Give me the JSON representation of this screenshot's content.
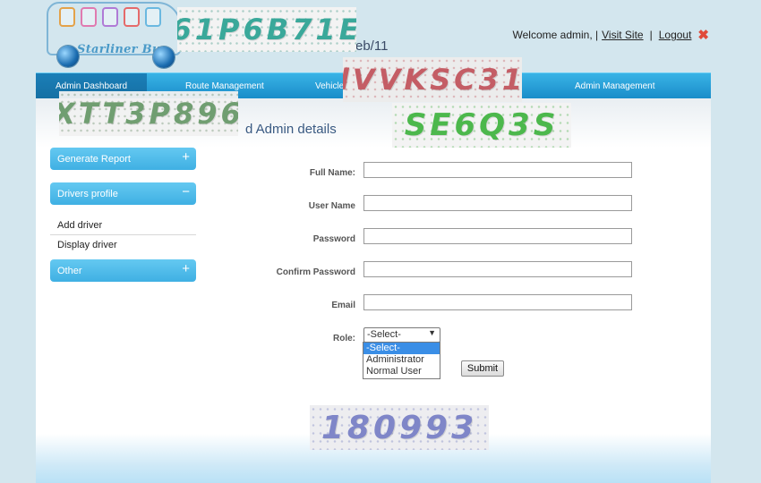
{
  "logo": {
    "brand": "Starliner Bus"
  },
  "header": {
    "date_fragment": "eb/11"
  },
  "topbar": {
    "welcome": "Welcome admin, |",
    "visit_site": "Visit Site",
    "divider": "|",
    "logout": "Logout",
    "logout_icon": "close-icon"
  },
  "nav": {
    "items": [
      {
        "label": "Admin Dashboard"
      },
      {
        "label": "Route Management"
      },
      {
        "label": "Vehicle"
      },
      {
        "label": "Admin Management"
      }
    ]
  },
  "page": {
    "title": "d Admin details"
  },
  "sidebar": {
    "sections": [
      {
        "label": "Generate Report",
        "sign": "+"
      },
      {
        "label": "Drivers profile",
        "sign": "−",
        "links": [
          "Add driver",
          "Display driver"
        ]
      },
      {
        "label": "Other",
        "sign": "+"
      }
    ]
  },
  "form": {
    "full_name": {
      "label": "Full Name:",
      "value": ""
    },
    "user_name": {
      "label": "User Name",
      "value": ""
    },
    "password": {
      "label": "Password",
      "value": ""
    },
    "confirm_password": {
      "label": "Confirm Password",
      "value": ""
    },
    "email": {
      "label": "Email",
      "value": ""
    },
    "role": {
      "label": "Role:",
      "selected": "-Select-",
      "options": [
        "-Select-",
        "Administrator",
        "Normal User"
      ]
    },
    "submit_label": "Submit"
  },
  "captchas": [
    "61P6B71E",
    "lVVKSC31",
    "XTT3P896",
    "SE6Q3S",
    "180993"
  ],
  "colors": {
    "nav_gradient_top": "#39b3e6",
    "nav_gradient_bottom": "#1a8dc9",
    "sidebar_accent": "#4fbdea",
    "logout_icon": "#e04a3a",
    "selected_option": "#3a8ee6"
  }
}
